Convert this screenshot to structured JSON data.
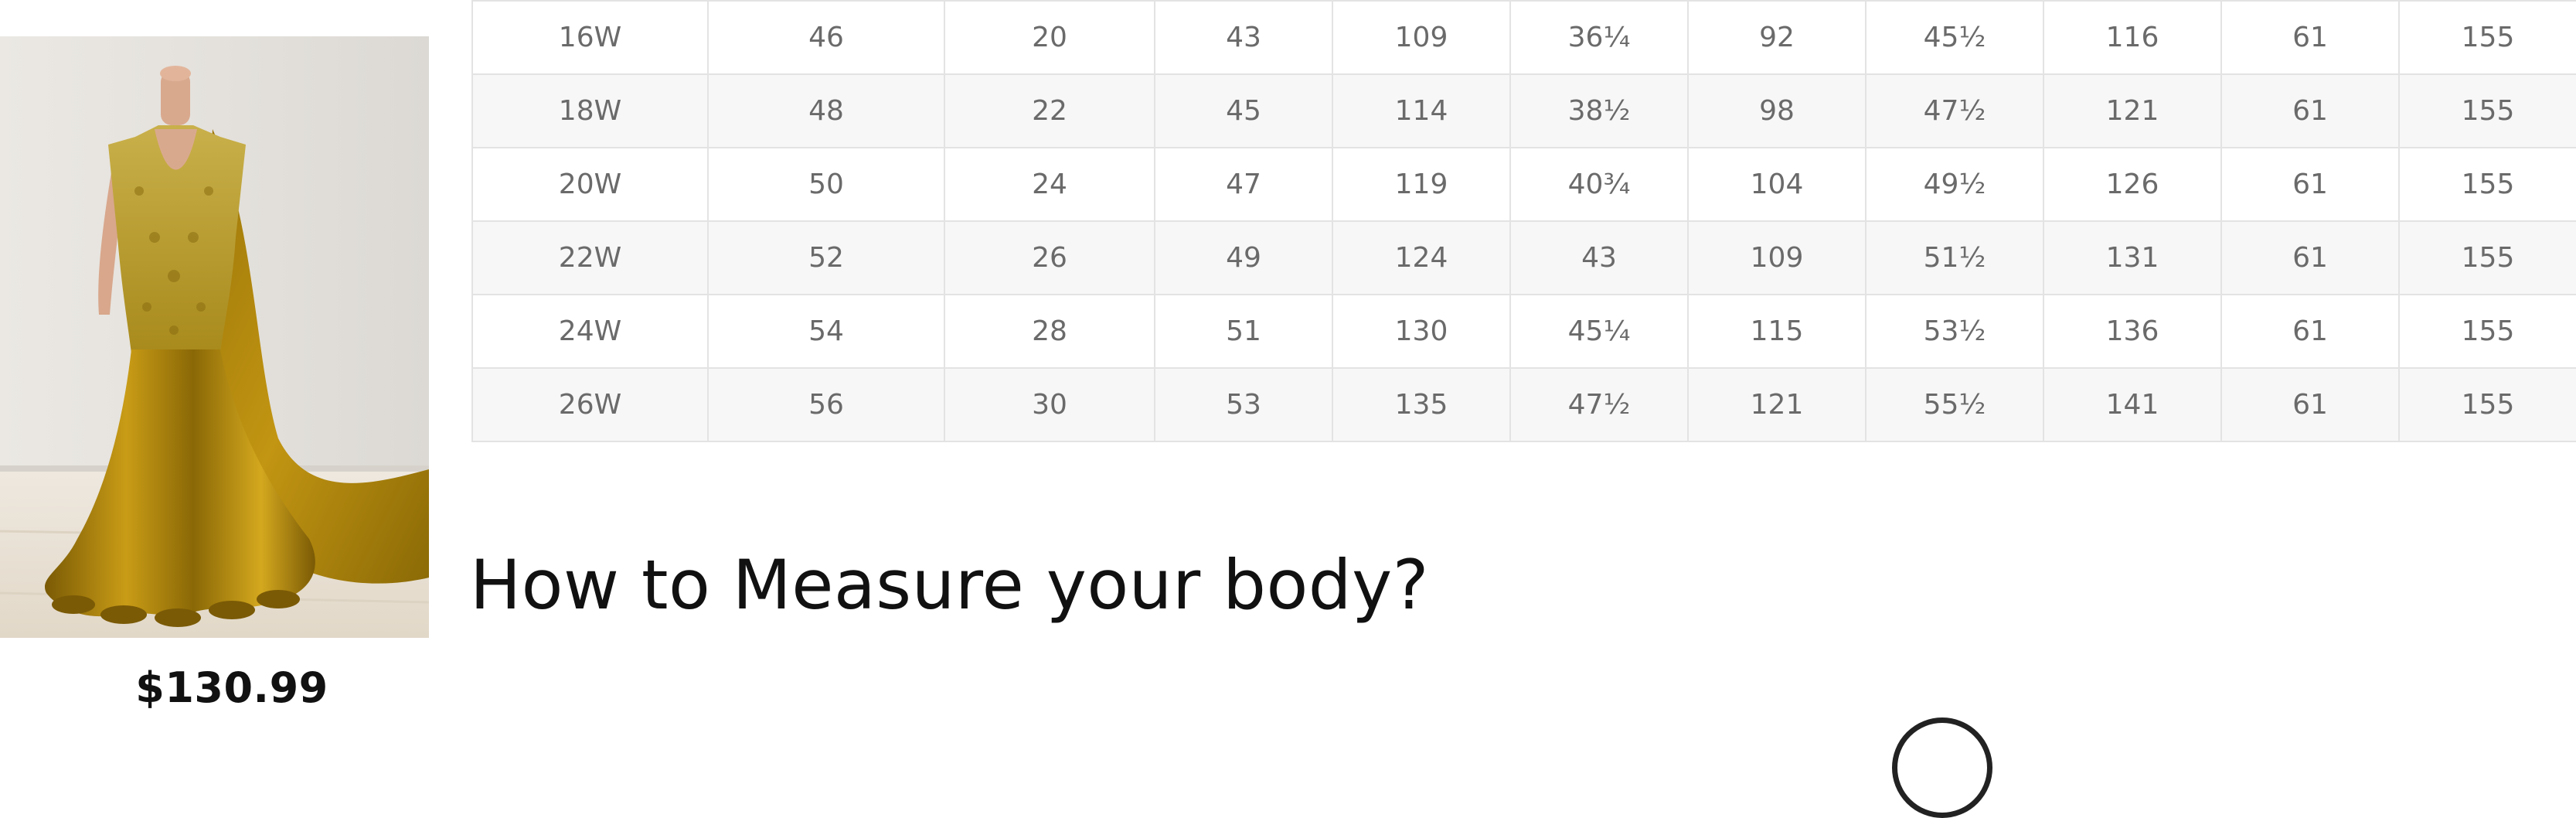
{
  "product": {
    "image_alt": "Gold velvet mermaid gown with beaded bodice and long cape train",
    "price": "$130.99"
  },
  "size_table": {
    "rows": [
      [
        "16W",
        "46",
        "20",
        "43",
        "109",
        "36¼",
        "92",
        "45½",
        "116",
        "61",
        "155"
      ],
      [
        "18W",
        "48",
        "22",
        "45",
        "114",
        "38½",
        "98",
        "47½",
        "121",
        "61",
        "155"
      ],
      [
        "20W",
        "50",
        "24",
        "47",
        "119",
        "40¾",
        "104",
        "49½",
        "126",
        "61",
        "155"
      ],
      [
        "22W",
        "52",
        "26",
        "49",
        "124",
        "43",
        "109",
        "51½",
        "131",
        "61",
        "155"
      ],
      [
        "24W",
        "54",
        "28",
        "51",
        "130",
        "45¼",
        "115",
        "53½",
        "136",
        "61",
        "155"
      ],
      [
        "26W",
        "56",
        "30",
        "53",
        "135",
        "47½",
        "121",
        "55½",
        "141",
        "61",
        "155"
      ]
    ]
  },
  "measure_section": {
    "heading": "How to Measure your body?"
  },
  "colors": {
    "table_border": "#e3e3e3",
    "table_text": "#6a6a6a",
    "row_alt_bg": "#f7f7f7",
    "gown_gold": "#b08a12",
    "heading_text": "#111111"
  },
  "icons": {
    "partial_circle": "circle-icon"
  }
}
